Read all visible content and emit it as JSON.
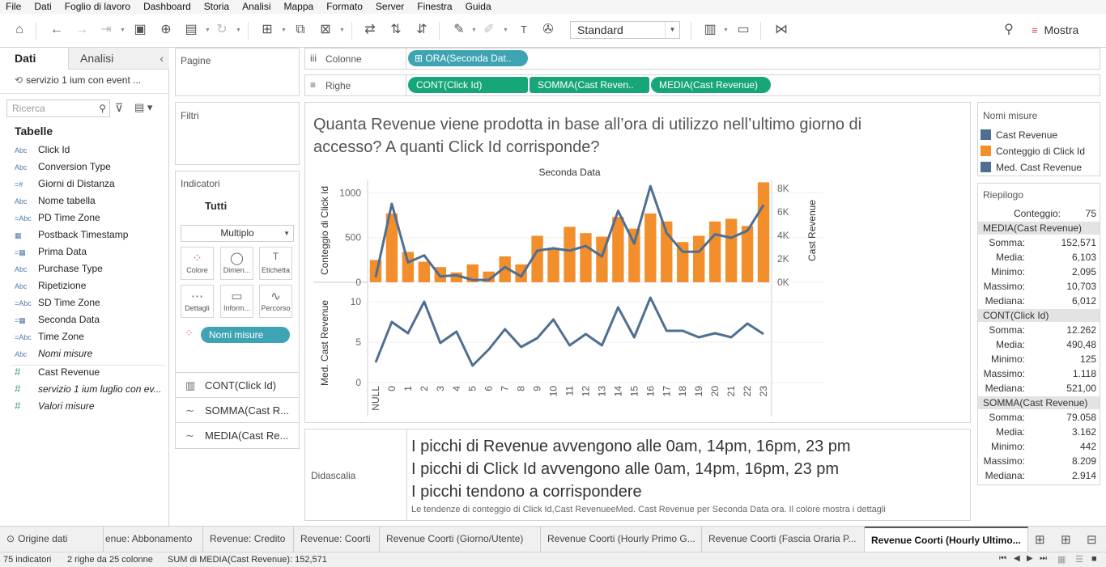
{
  "menu": [
    "File",
    "Dati",
    "Foglio di lavoro",
    "Dashboard",
    "Storia",
    "Analisi",
    "Mappa",
    "Formato",
    "Server",
    "Finestra",
    "Guida"
  ],
  "toolbar": {
    "fit_select": "Standard",
    "show_me": "Mostra"
  },
  "datapane": {
    "tab_data": "Dati",
    "tab_analytics": "Analisi",
    "datasource": "servizio 1 ium con event ...",
    "search_placeholder": "Ricerca",
    "tables_label": "Tabelle",
    "dimensions": [
      {
        "type": "Abc",
        "name": "Click Id"
      },
      {
        "type": "Abc",
        "name": "Conversion Type"
      },
      {
        "type": "=#",
        "name": "Giorni di Distanza"
      },
      {
        "type": "Abc",
        "name": "Nome tabella"
      },
      {
        "type": "=Abc",
        "name": "PD Time Zone"
      },
      {
        "type": "cal",
        "name": "Postback Timestamp"
      },
      {
        "type": "=cal",
        "name": "Prima Data"
      },
      {
        "type": "Abc",
        "name": "Purchase Type"
      },
      {
        "type": "Abc",
        "name": "Ripetizione"
      },
      {
        "type": "=Abc",
        "name": "SD Time Zone"
      },
      {
        "type": "=cal",
        "name": "Seconda Data"
      },
      {
        "type": "=Abc",
        "name": "Time Zone"
      },
      {
        "type": "Abc",
        "name": "Nomi misure"
      }
    ],
    "measures": [
      {
        "name": "Cast Revenue"
      },
      {
        "name": "servizio 1 ium luglio con ev..."
      },
      {
        "name": "Valori misure"
      }
    ]
  },
  "shelves": {
    "pages": "Pagine",
    "filters": "Filtri",
    "columns_label": "Colonne",
    "rows_label": "Righe",
    "columns_pill": "ORA(Seconda Dat..",
    "rows_pills": [
      "CONT(Click Id)",
      "SOMMA(Cast Reven..",
      "MEDIA(Cast Revenue)"
    ]
  },
  "marks": {
    "title": "Indicatori",
    "all": "Tutti",
    "type": "Multiplo",
    "buttons": [
      "Colore",
      "Dimen...",
      "Etichetta",
      "Dettagli",
      "Inform...",
      "Percorso"
    ],
    "color_pill": "Nomi misure",
    "rows": [
      "CONT(Click Id)",
      "SOMMA(Cast R...",
      "MEDIA(Cast Re..."
    ]
  },
  "viz": {
    "title": "Quanta Revenue viene prodotta in base all’ora di utilizzo nell’ultimo giorno di accesso? A quanti Click Id corrisponde?",
    "header": "Seconda Data",
    "y1_label": "Conteggio di Click Id",
    "y2_label": "Cast Revenue",
    "y3_label": "Med. Cast Revenue"
  },
  "chart_data": {
    "type": "bar",
    "title": "Quanta Revenue viene prodotta in base all’ora di utilizzo nell’ultimo giorno di accesso? A quanti Click Id corrisponde?",
    "xlabel": "Seconda Data",
    "categories": [
      "NULL",
      "0",
      "1",
      "2",
      "3",
      "4",
      "5",
      "6",
      "7",
      "8",
      "9",
      "10",
      "11",
      "12",
      "13",
      "14",
      "15",
      "16",
      "17",
      "18",
      "19",
      "20",
      "21",
      "22",
      "23"
    ],
    "series": [
      {
        "name": "Conteggio di Click Id",
        "type": "bar",
        "axis": "left",
        "color": "#f28e2b",
        "values": [
          250,
          770,
          340,
          230,
          170,
          110,
          200,
          120,
          290,
          200,
          520,
          380,
          620,
          550,
          510,
          730,
          600,
          770,
          680,
          450,
          520,
          680,
          710,
          630,
          1118
        ]
      },
      {
        "name": "Cast Revenue",
        "type": "line",
        "axis": "right",
        "color": "#4e6f91",
        "values": [
          442,
          6700,
          1700,
          2300,
          500,
          600,
          200,
          200,
          1300,
          500,
          2700,
          2900,
          2700,
          3100,
          2200,
          6100,
          3300,
          8209,
          4200,
          2600,
          2600,
          4100,
          3800,
          4400,
          6600
        ]
      },
      {
        "name": "Med. Cast Revenue",
        "type": "line",
        "axis": "lower",
        "color": "#4e6f91",
        "values": [
          2.5,
          7.5,
          6.1,
          10.0,
          4.9,
          6.3,
          2.1,
          4.1,
          6.6,
          4.4,
          5.5,
          7.8,
          4.6,
          6.0,
          4.6,
          9.3,
          5.6,
          10.5,
          6.4,
          6.4,
          5.6,
          6.1,
          5.6,
          7.3,
          6.0
        ]
      }
    ],
    "y_left": {
      "ticks": [
        "0",
        "500",
        "1000"
      ],
      "ylim": [
        0,
        1140
      ]
    },
    "y_right": {
      "ticks": [
        "0K",
        "2K",
        "4K",
        "6K",
        "8K"
      ],
      "ylim": [
        0,
        8700
      ]
    },
    "y_lower": {
      "ticks": [
        "0",
        "5",
        "10"
      ],
      "ylim": [
        0,
        11
      ]
    }
  },
  "caption": {
    "label": "Didascalia",
    "lines": [
      "I picchi di Revenue avvengono alle 0am, 14pm, 16pm, 23 pm",
      "I picchi di Click Id avvengono alle 0am, 14pm, 16pm, 23 pm",
      "I picchi tendono a corrispondere"
    ],
    "small": "Le tendenze di conteggio di Click Id,Cast RevenueeMed. Cast Revenue per Seconda Data ora.  Il colore mostra i dettagli"
  },
  "legend": {
    "title": "Nomi misure",
    "items": [
      {
        "label": "Cast Revenue",
        "color": "#4e6f91"
      },
      {
        "label": "Conteggio di Click Id",
        "color": "#f28e2b"
      },
      {
        "label": "Med. Cast Revenue",
        "color": "#4e6f91"
      }
    ]
  },
  "summary": {
    "title": "Riepilogo",
    "count_label": "Conteggio:",
    "count_value": "75",
    "groups": [
      {
        "head": "MEDIA(Cast Revenue)",
        "rows": [
          [
            "Somma:",
            "152,571"
          ],
          [
            "Media:",
            "6,103"
          ],
          [
            "Minimo:",
            "2,095"
          ],
          [
            "Massimo:",
            "10,703"
          ],
          [
            "Mediana:",
            "6,012"
          ]
        ]
      },
      {
        "head": "CONT(Click Id)",
        "rows": [
          [
            "Somma:",
            "12.262"
          ],
          [
            "Media:",
            "490,48"
          ],
          [
            "Minimo:",
            "125"
          ],
          [
            "Massimo:",
            "1.118"
          ],
          [
            "Mediana:",
            "521,00"
          ]
        ]
      },
      {
        "head": "SOMMA(Cast Revenue)",
        "rows": [
          [
            "Somma:",
            "79.058"
          ],
          [
            "Media:",
            "3.162"
          ],
          [
            "Minimo:",
            "442"
          ],
          [
            "Massimo:",
            "8.209"
          ],
          [
            "Mediana:",
            "2.914"
          ]
        ]
      }
    ]
  },
  "tabs": [
    "Origine dati",
    "enue: Abbonamento",
    "Revenue: Credito",
    "Revenue: Coorti",
    "Revenue Coorti (Giorno/Utente)",
    "Revenue Coorti (Hourly Primo G...",
    "Revenue Coorti (Fascia Oraria P...",
    "Revenue Coorti (Hourly Ultimo..."
  ],
  "status": {
    "marks": "75 indicatori",
    "rows": "2 righe da 25 colonne",
    "sum": "SUM di MEDIA(Cast Revenue): 152,571"
  }
}
